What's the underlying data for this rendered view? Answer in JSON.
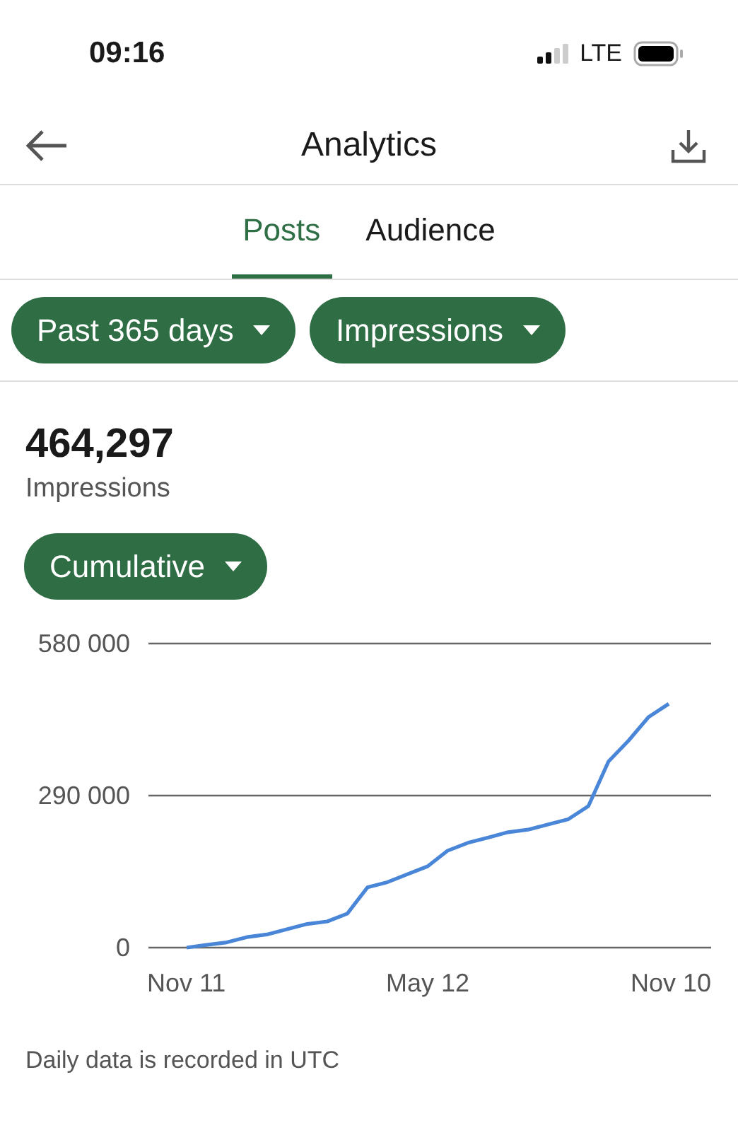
{
  "status_bar": {
    "time": "09:16",
    "network": "LTE"
  },
  "header": {
    "title": "Analytics"
  },
  "tabs": [
    {
      "label": "Posts",
      "selected": true
    },
    {
      "label": "Audience",
      "selected": false
    }
  ],
  "filters": [
    {
      "label": "Past 365 days"
    },
    {
      "label": "Impressions"
    }
  ],
  "summary": {
    "value": "464,297",
    "label": "Impressions"
  },
  "mode": {
    "label": "Cumulative"
  },
  "chart": {
    "chart_data": {
      "type": "line",
      "categories": [
        "Nov 11",
        null,
        null,
        null,
        null,
        null,
        null,
        null,
        null,
        null,
        null,
        null,
        "May 12",
        null,
        null,
        null,
        null,
        null,
        null,
        null,
        null,
        null,
        null,
        null,
        "Nov 10"
      ],
      "series": [
        {
          "color": "#4a86d8",
          "values": [
            0,
            5000,
            10000,
            20000,
            25000,
            35000,
            45000,
            50000,
            65000,
            115000,
            125000,
            140000,
            155000,
            185000,
            200000,
            210000,
            220000,
            225000,
            235000,
            245000,
            270000,
            355000,
            395000,
            440000,
            465000
          ]
        }
      ],
      "ylim": [
        0,
        580000
      ],
      "yticks": [
        {
          "value": 0,
          "label": "0"
        },
        {
          "value": 290000,
          "label": "290 000"
        },
        {
          "value": 580000,
          "label": "580 000"
        }
      ]
    }
  },
  "footnote": "Daily data is recorded in UTC"
}
